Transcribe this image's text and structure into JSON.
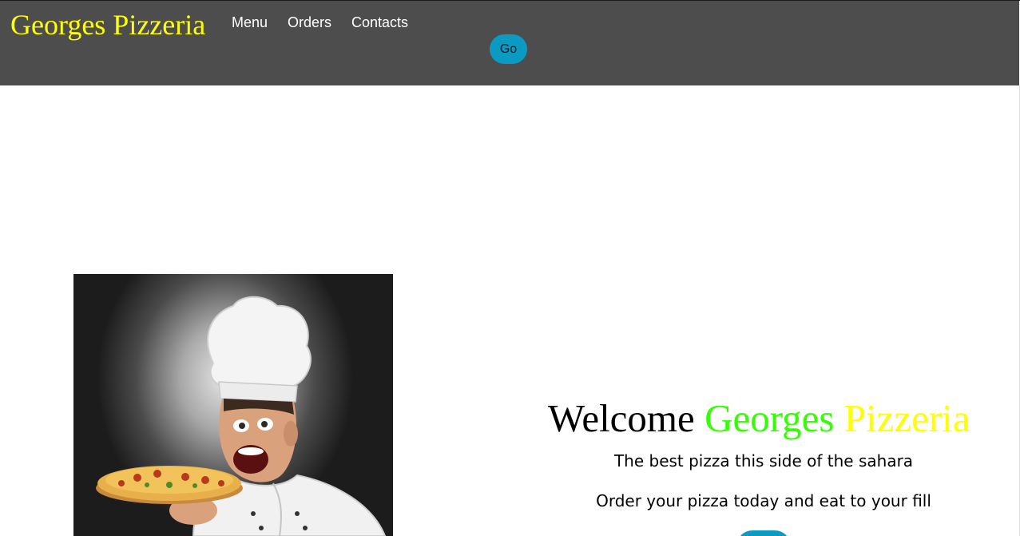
{
  "header": {
    "brand": "Georges Pizzeria",
    "nav": [
      {
        "label": "Menu"
      },
      {
        "label": "Orders"
      },
      {
        "label": "Contacts"
      }
    ],
    "go_label": "Go"
  },
  "hero": {
    "heading_word": "Welcome",
    "heading_name_1": "Georges",
    "heading_name_2": "Pizzeria",
    "tagline_1": "The best pizza this side of the sahara",
    "tagline_2": "Order your pizza today and eat to your fill",
    "order_button_label": ""
  },
  "colors": {
    "navbar_bg": "#4d4d4d",
    "brand": "#ffff00",
    "accent_green": "#33ff00",
    "button": "#0b9bc2"
  },
  "image": {
    "subject": "chef-holding-pizza-photo"
  }
}
